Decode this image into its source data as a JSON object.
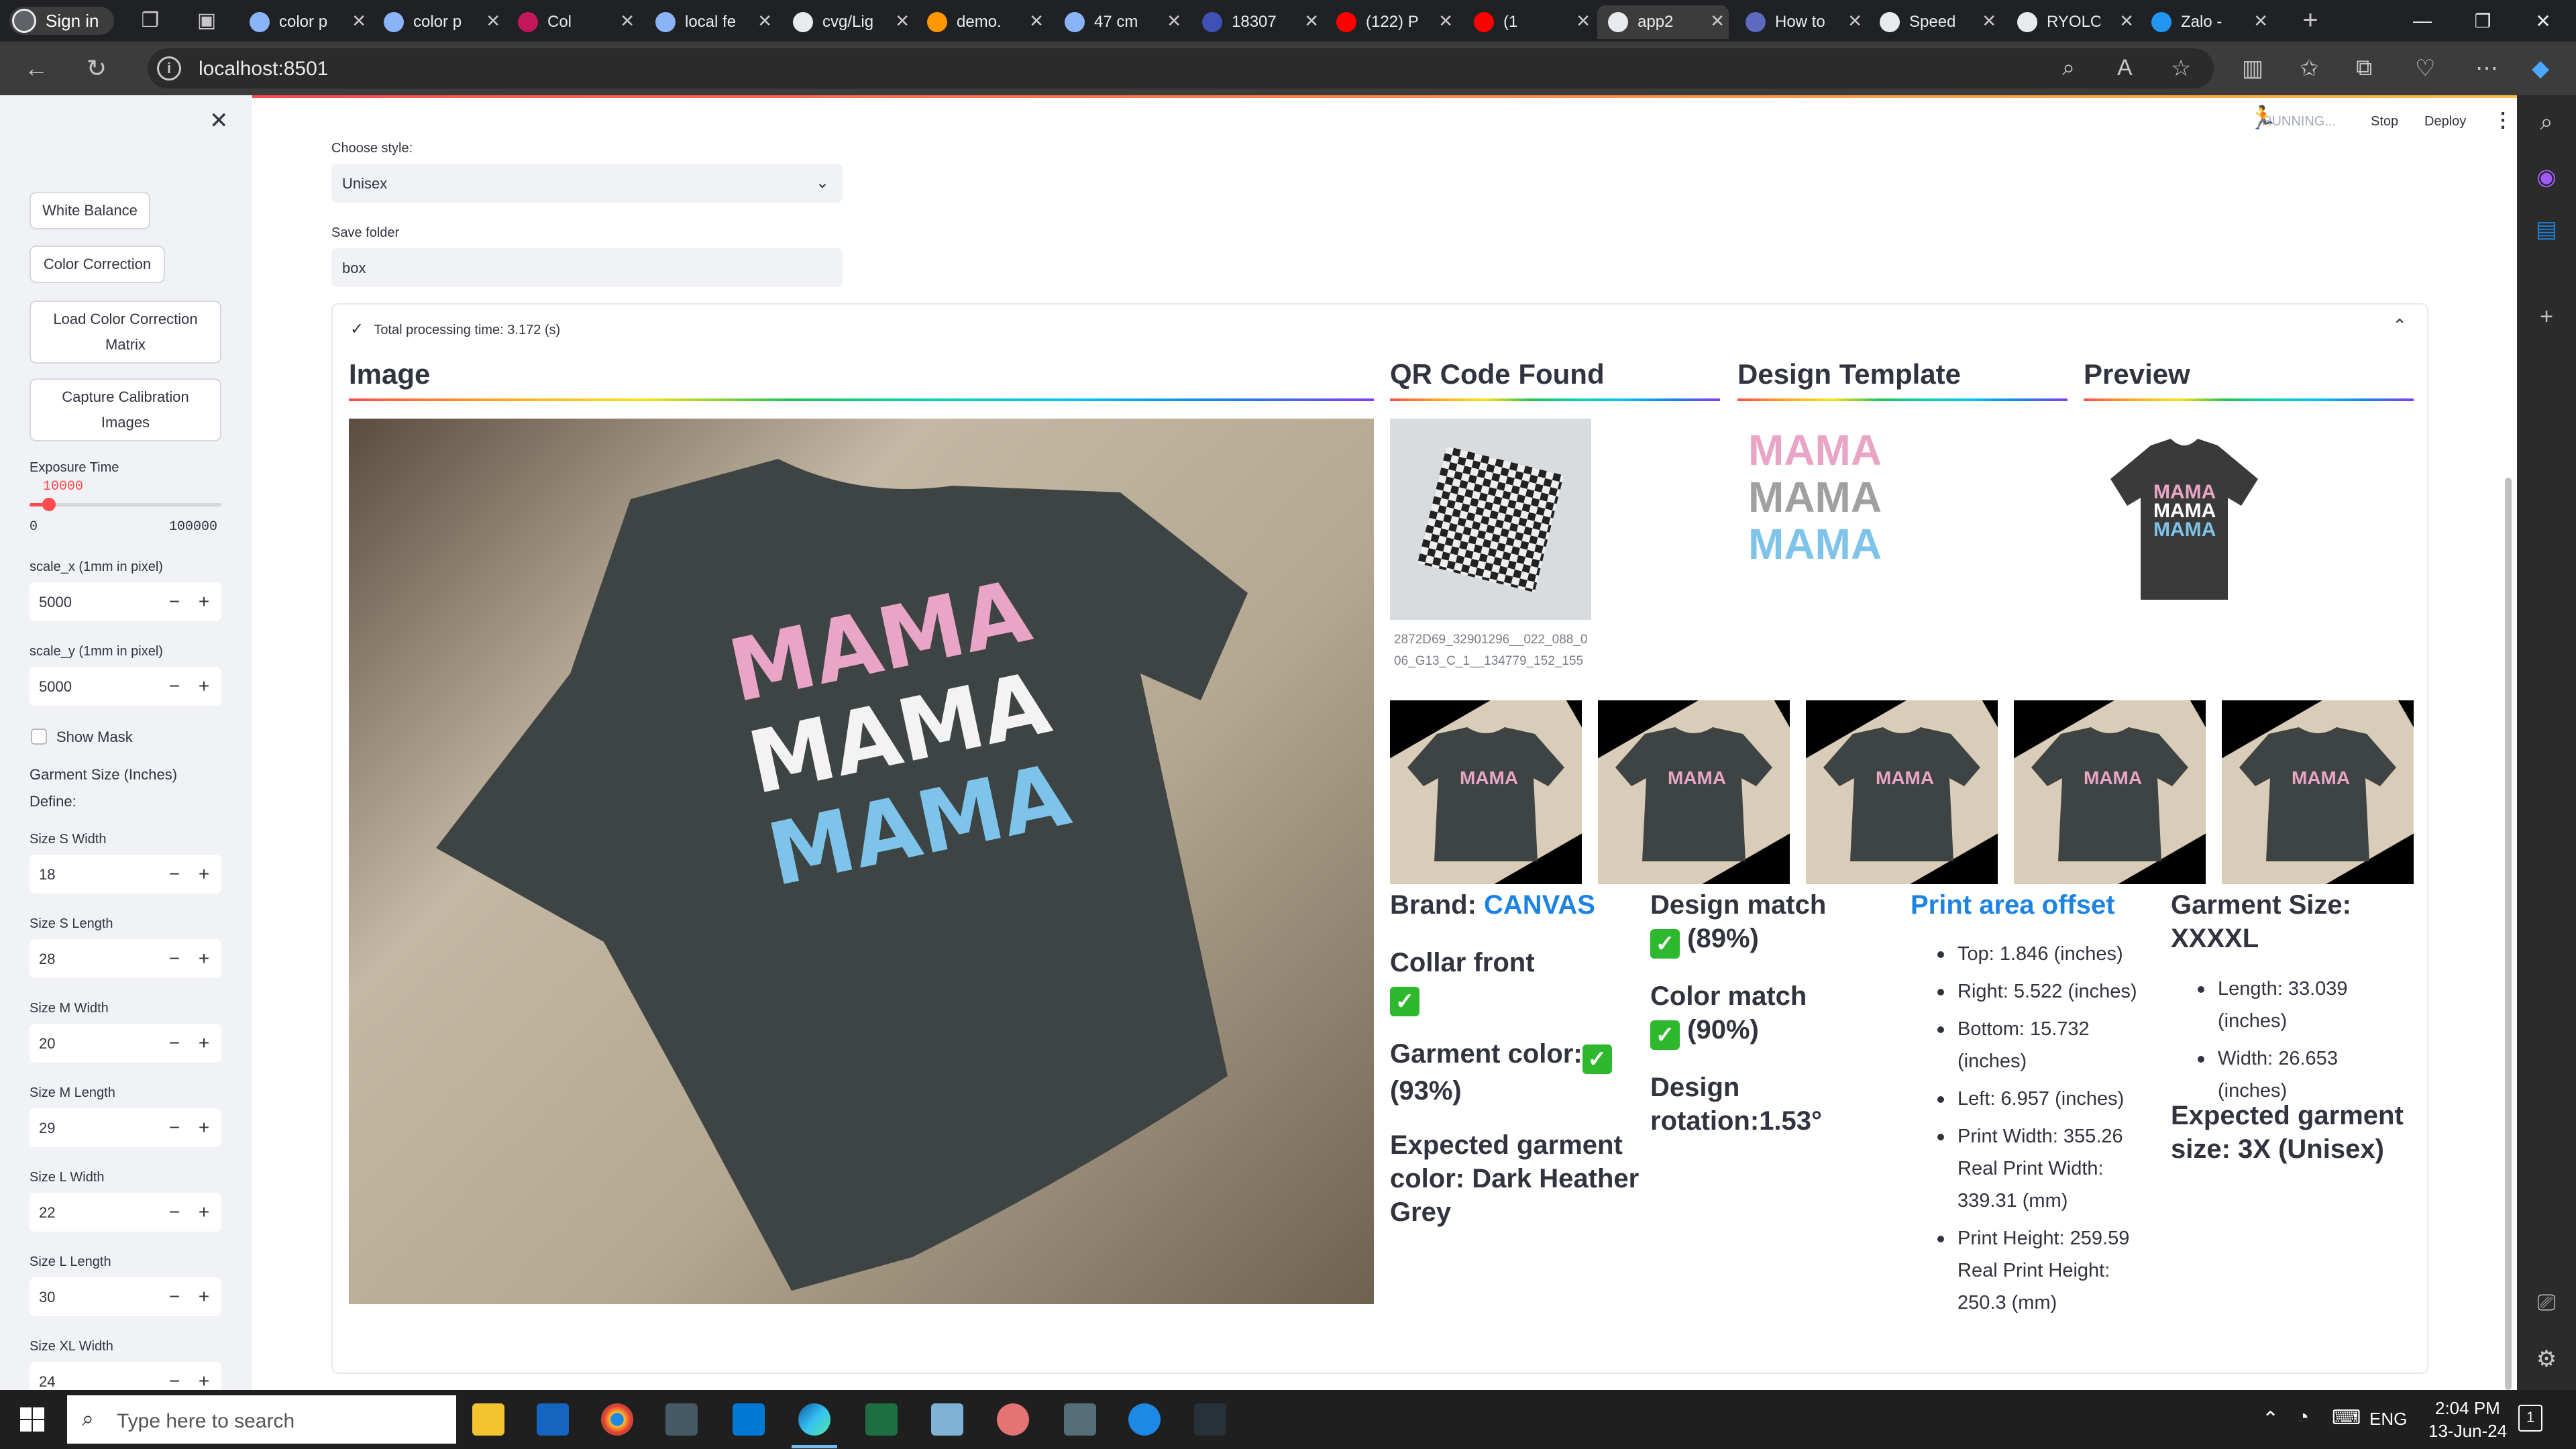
{
  "browser": {
    "signin_label": "Sign in",
    "tabs": [
      {
        "title": "color p",
        "color": "#8ab4f8"
      },
      {
        "title": "color p",
        "color": "#8ab4f8"
      },
      {
        "title": "Col",
        "color": "#c2185b"
      },
      {
        "title": "local fe",
        "color": "#8ab4f8"
      },
      {
        "title": "cvg/Lig",
        "color": "#e8eaed"
      },
      {
        "title": "demo.",
        "color": "#ff9800"
      },
      {
        "title": "47 cm",
        "color": "#8ab4f8"
      },
      {
        "title": "18307",
        "color": "#3f51b5"
      },
      {
        "title": "(122) P",
        "color": "#ff0000"
      },
      {
        "title": "(1",
        "color": "#ff0000"
      },
      {
        "title": "app2",
        "color": "#e8eaed"
      },
      {
        "title": "How to",
        "color": "#5c6bc0"
      },
      {
        "title": "Speed",
        "color": "#e8eaed"
      },
      {
        "title": "RYOLO",
        "color": "#e8eaed"
      },
      {
        "title": "Zalo -",
        "color": "#2196f3"
      }
    ],
    "url": "localhost:8501"
  },
  "header": {
    "status": "RUNNING...",
    "stop_label": "Stop",
    "deploy_label": "Deploy"
  },
  "sidebar": {
    "buttons": {
      "white_balance": "White Balance",
      "color_correction": "Color Correction",
      "load_matrix": "Load Color Correction Matrix",
      "capture": "Capture Calibration Images"
    },
    "exposure": {
      "label": "Exposure Time",
      "value": "10000",
      "min": "0",
      "max": "100000",
      "fraction": 0.1
    },
    "scale_x": {
      "label": "scale_x (1mm in pixel)",
      "value": "5000"
    },
    "scale_y": {
      "label": "scale_y (1mm in pixel)",
      "value": "5000"
    },
    "show_mask": "Show Mask",
    "garment_size": "Garment Size (Inches)",
    "define": "Define:",
    "sizes": [
      {
        "label": "Size S Width",
        "value": "18"
      },
      {
        "label": "Size S Length",
        "value": "28"
      },
      {
        "label": "Size M Width",
        "value": "20"
      },
      {
        "label": "Size M Length",
        "value": "29"
      },
      {
        "label": "Size L Width",
        "value": "22"
      },
      {
        "label": "Size L Length",
        "value": "30"
      },
      {
        "label": "Size XL Width",
        "value": "24"
      }
    ]
  },
  "main": {
    "style_label": "Choose style:",
    "style_value": "Unisex",
    "folder_label": "Save folder",
    "folder_value": "box",
    "processing_time": "Total processing time: 3.172 (s)",
    "headings": {
      "image": "Image",
      "qr": "QR Code Found",
      "template": "Design Template",
      "preview": "Preview"
    },
    "qr_caption": "2872D69_32901296__022_088_006_G13_C_1__134779_152_155",
    "design_text": "MAMA",
    "results": {
      "brand_label": "Brand: ",
      "brand_value": "CANVAS",
      "collar": "Collar front",
      "garment_color": "Garment color:",
      "garment_color_pct": "(93%)",
      "expected_color": "Expected garment color: Dark Heather Grey",
      "design_match": "Design match",
      "design_match_pct": "(89%)",
      "color_match": "Color match",
      "color_match_pct": "(90%)",
      "rotation": "Design rotation:1.53°",
      "offset_title": "Print area offset",
      "offsets": [
        "Top: 1.846 (inches)",
        "Right: 5.522 (inches)",
        "Bottom: 15.732 (inches)",
        "Left: 6.957 (inches)",
        "Print Width: 355.26 Real Print Width: 339.31 (mm)",
        "Print Height: 259.59 Real Print Height: 250.3 (mm)"
      ],
      "garment_size": "Garment Size: XXXXL",
      "size_items": [
        "Length: 33.039 (inches)",
        "Width: 26.653 (inches)"
      ],
      "expected_size": "Expected garment size: 3X (Unisex)"
    }
  },
  "taskbar": {
    "search_placeholder": "Type here to search",
    "lang": "ENG",
    "time": "2:04 PM",
    "date": "13-Jun-24",
    "notif_count": "1"
  }
}
